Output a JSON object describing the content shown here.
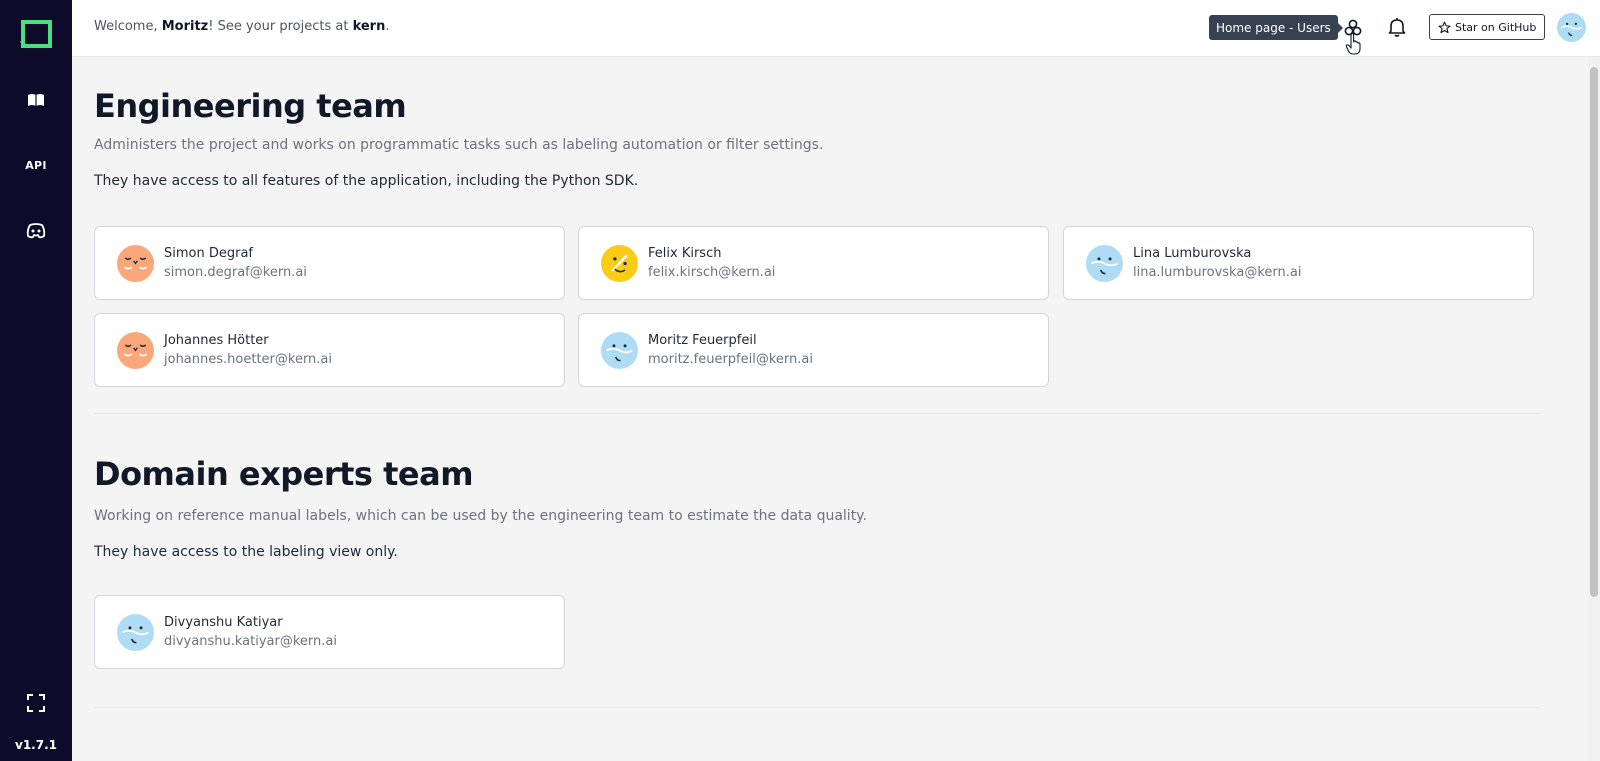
{
  "sidebar": {
    "items": [
      {
        "name": "book-icon"
      },
      {
        "label": "API"
      },
      {
        "name": "discord-icon"
      }
    ],
    "fullscreen_icon": "fullscreen-icon",
    "version": "v1.7.1"
  },
  "header": {
    "welcome_prefix": "Welcome, ",
    "user_name": "Moritz",
    "welcome_middle": "! See your projects at ",
    "brand": "kern",
    "welcome_suffix": ".",
    "tooltip": "Home page - Users",
    "github_label": "Star on GitHub"
  },
  "engineering": {
    "title": "Engineering team",
    "description": "Administers the project and works on programmatic tasks such as labeling automation or filter settings.",
    "access": "They have access to all features of the application, including the Python SDK.",
    "members": [
      {
        "name": "Simon Degraf",
        "email": "simon.degraf@kern.ai",
        "avatar": "orange"
      },
      {
        "name": "Felix Kirsch",
        "email": "felix.kirsch@kern.ai",
        "avatar": "yellow"
      },
      {
        "name": "Lina Lumburovska",
        "email": "lina.lumburovska@kern.ai",
        "avatar": "blue"
      },
      {
        "name": "Johannes Hötter",
        "email": "johannes.hoetter@kern.ai",
        "avatar": "orange"
      },
      {
        "name": "Moritz Feuerpfeil",
        "email": "moritz.feuerpfeil@kern.ai",
        "avatar": "blue"
      }
    ]
  },
  "domain": {
    "title": "Domain experts team",
    "description": "Working on reference manual labels, which can be used by the engineering team to estimate the data quality.",
    "access": "They have access to the labeling view only.",
    "members": [
      {
        "name": "Divyanshu Katiyar",
        "email": "divyanshu.katiyar@kern.ai",
        "avatar": "blue"
      }
    ]
  },
  "colors": {
    "sidebar": "#0d0a2a",
    "logo_green": "#4ade80",
    "avatar_orange": "#f9a77b",
    "avatar_yellow": "#facc15",
    "avatar_blue": "#aedcf5"
  }
}
